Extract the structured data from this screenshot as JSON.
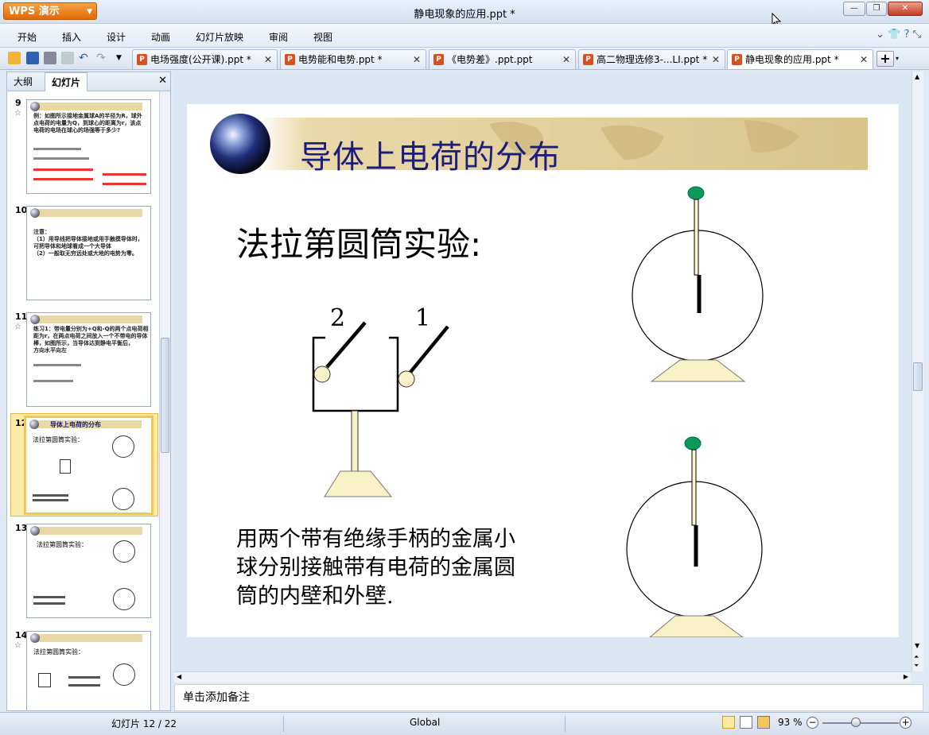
{
  "app": {
    "name": "WPS 演示",
    "window_title": "静电现象的应用.ppt *"
  },
  "menu": [
    "开始",
    "插入",
    "设计",
    "动画",
    "幻灯片放映",
    "审阅",
    "视图"
  ],
  "doc_tabs": [
    {
      "label": "电场强度(公开课).ppt *",
      "active": false
    },
    {
      "label": "电势能和电势.ppt *",
      "active": false
    },
    {
      "label": "《电势差》.ppt.ppt",
      "active": false
    },
    {
      "label": "高二物理选修3-...LI.ppt *",
      "active": false
    },
    {
      "label": "静电现象的应用.ppt *",
      "active": true
    }
  ],
  "panel": {
    "tab_outline": "大纲",
    "tab_slides": "幻灯片"
  },
  "thumbnails": [
    {
      "num": "9",
      "text": "例：如图所示接地金属球A的半径为R，球外\n点电荷的电量为Q，到球心的距离为r，该点\n电荷的电场在球心的场强等于多少?"
    },
    {
      "num": "10",
      "text": "注意：\n（1）用导线把导体接地或用手触摸导体时，\n可把导体和地球看成一个大导体\n（2）一般取无穷远处或大地的电势为零。"
    },
    {
      "num": "11",
      "text": "练习1：带电量分别为+Q和-Q的两个点电荷相\n距为r，在两点电荷之间放入一个不带电的导体\n棒，如图所示，当导体达到静电平衡后，\n方向水平向左"
    },
    {
      "num": "12",
      "title": "导体上电荷的分布",
      "text": "法拉第圆筒实验："
    },
    {
      "num": "13",
      "text": "法拉第圆筒实验："
    },
    {
      "num": "14",
      "text": "法拉第圆筒实验："
    }
  ],
  "slide": {
    "title": "导体上电荷的分布",
    "subtitle": "法拉第圆筒实验:",
    "label_2": "2",
    "label_1": "1",
    "body": "用两个带有绝缘手柄的金属小球分别接触带有电荷的金属圆筒的内壁和外壁."
  },
  "notes_placeholder": "单击添加备注",
  "status": {
    "slide_indicator": "幻灯片 12 / 22",
    "language": "Global",
    "zoom": "93 %"
  }
}
